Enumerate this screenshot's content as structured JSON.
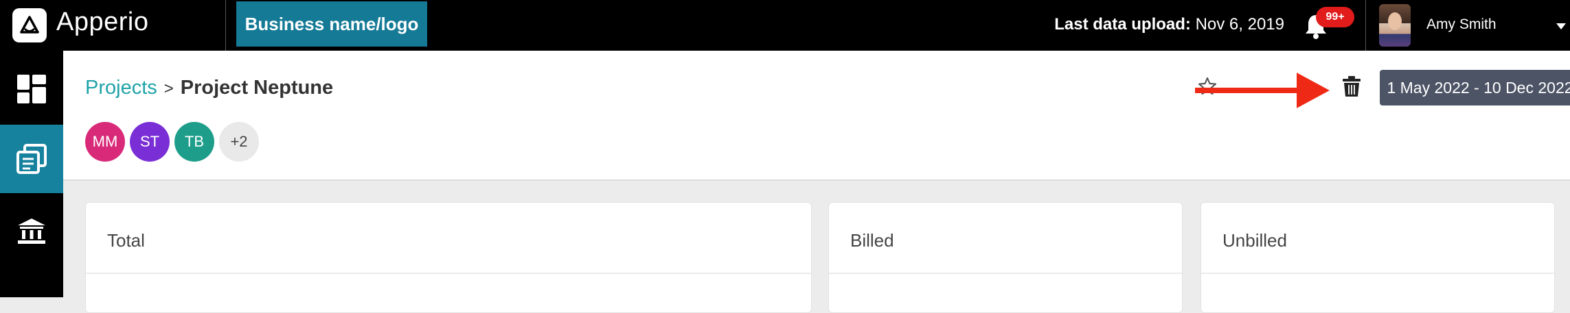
{
  "app": {
    "name": "Apperio"
  },
  "topbar": {
    "business_label": "Business name/logo",
    "upload_label": "Last data upload:",
    "upload_date": "Nov 6, 2019",
    "notifications_count": "99+",
    "user_name": "Amy Smith"
  },
  "nav": {
    "items": [
      {
        "icon": "dashboard-icon",
        "active": false
      },
      {
        "icon": "documents-icon",
        "active": true
      },
      {
        "icon": "bank-icon",
        "active": false
      }
    ]
  },
  "breadcrumb": {
    "parent": "Projects",
    "separator": ">",
    "current": "Project Neptune"
  },
  "members": [
    {
      "initials": "MM",
      "color": "#d92a7a"
    },
    {
      "initials": "ST",
      "color": "#7a2fd6"
    },
    {
      "initials": "TB",
      "color": "#1e9e8a"
    },
    {
      "initials": "+2",
      "color": "#e9e9e9"
    }
  ],
  "date_range": {
    "label": "1 May 2022 - 10 Dec 2022"
  },
  "cards": [
    {
      "title": "Total"
    },
    {
      "title": "Billed"
    },
    {
      "title": "Unbilled"
    }
  ],
  "colors": {
    "brand_teal": "#1fa3a8",
    "business_button": "#157a96",
    "active_nav": "#16829e",
    "notification": "#e21b1b",
    "annotation_arrow": "#ee2a16",
    "date_range_bg": "#4c5466"
  }
}
